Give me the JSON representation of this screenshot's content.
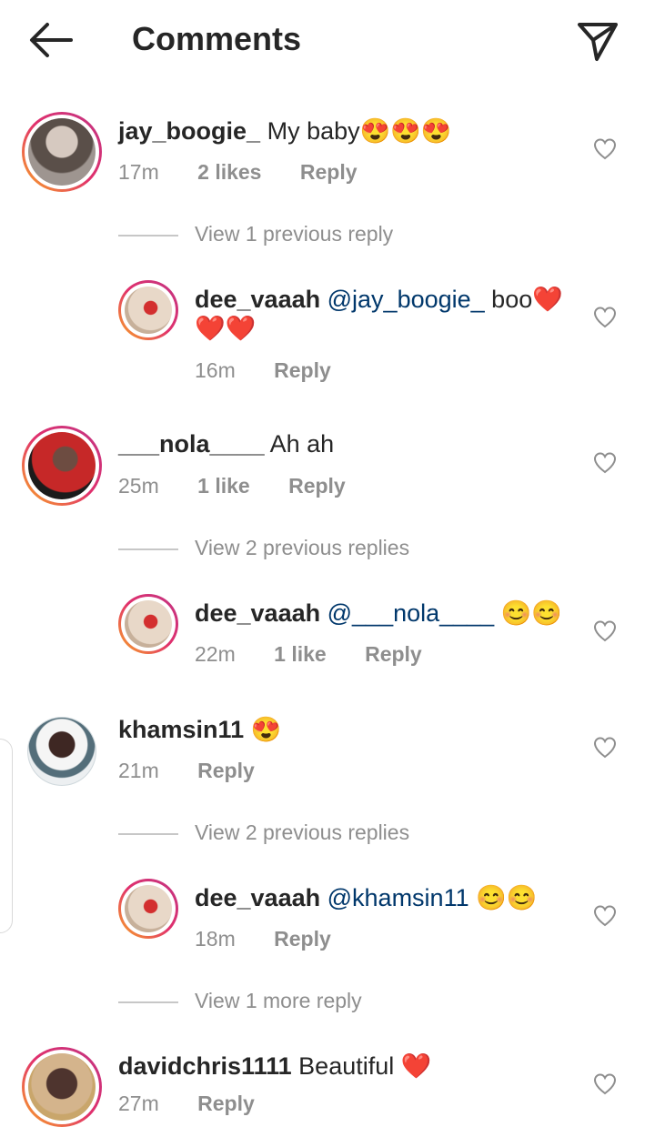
{
  "header": {
    "title": "Comments"
  },
  "comments": [
    {
      "username": "jay_boogie_",
      "text": "My baby😍😍😍",
      "time": "17m",
      "likes": "2 likes",
      "reply": "Reply",
      "view_replies": "View 1 previous reply"
    },
    {
      "username": "dee_vaaah",
      "mention": "@jay_boogie_",
      "text": " boo❤️",
      "text2": "❤️❤️",
      "time": "16m",
      "reply": "Reply"
    },
    {
      "username": "___nola____",
      "text": "Ah ah",
      "time": "25m",
      "likes": "1 like",
      "reply": "Reply",
      "view_replies": "View 2 previous replies"
    },
    {
      "username": "dee_vaaah",
      "mention": "@___nola____",
      "text": " 😊😊",
      "time": "22m",
      "likes": "1 like",
      "reply": "Reply"
    },
    {
      "username": "khamsin11",
      "text": "😍",
      "time": "21m",
      "reply": "Reply",
      "view_replies": "View 2 previous replies"
    },
    {
      "username": "dee_vaaah",
      "mention": "@khamsin11",
      "text": " 😊😊",
      "time": "18m",
      "reply": "Reply",
      "view_more": "View 1 more reply"
    },
    {
      "username": "davidchris1111",
      "text": "Beautiful ❤️",
      "time": "27m",
      "reply": "Reply"
    }
  ],
  "icons": {
    "back": "arrow-left-icon",
    "send": "paper-plane-icon",
    "like": "heart-outline-icon"
  },
  "colors": {
    "mention": "#00376b",
    "meta": "#8e8e8e",
    "story_ring": "#e1306c"
  }
}
